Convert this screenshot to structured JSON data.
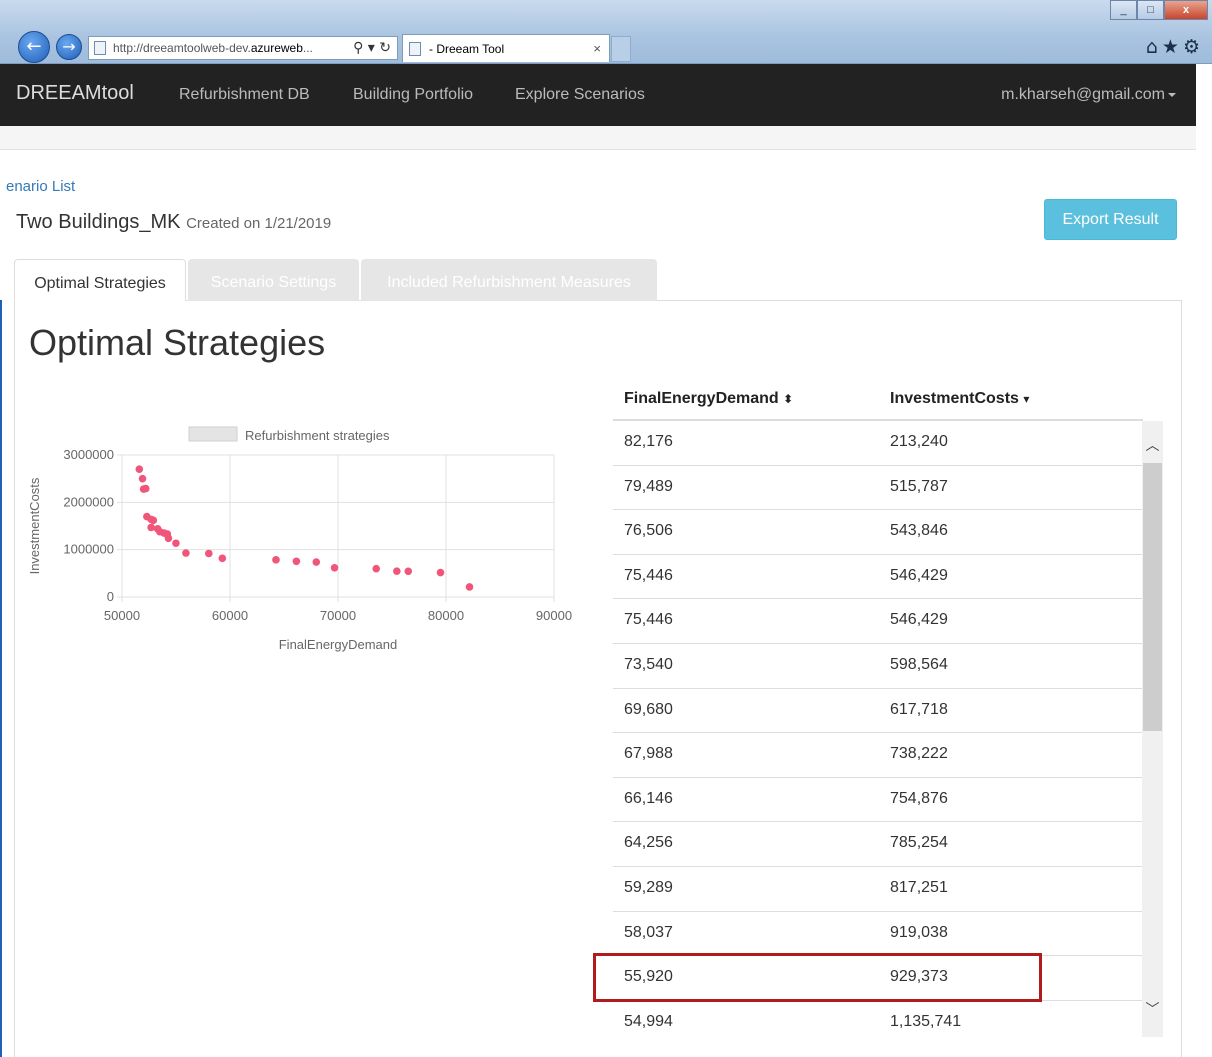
{
  "browser": {
    "url_prefix": "http://dreeamtoolweb-dev.",
    "url_bold": "azureweb",
    "url_suffix": "...",
    "tab_title": "- Dreeam Tool",
    "tab_close": "×",
    "back_glyph": "←",
    "forward_glyph": "→",
    "addr_tools": "⚲ ▾ ↻",
    "window_buttons": {
      "minimize": "_",
      "maximize": "□",
      "close": "x"
    },
    "toolbar_icons": "⌂★⚙"
  },
  "navbar": {
    "brand": "DREEAMtool",
    "links": [
      "Refurbishment DB",
      "Building Portfolio",
      "Explore Scenarios"
    ],
    "user": "m.kharseh@gmail.com"
  },
  "page": {
    "breadcrumb": "enario List",
    "title": "Two Buildings_MK",
    "created": "Created on 1/21/2019",
    "export_button": "Export Result",
    "tabs": [
      "Optimal Strategies",
      "Scenario Settings",
      "Included Refurbishment Measures"
    ],
    "heading": "Optimal Strategies"
  },
  "chart_data": {
    "type": "scatter",
    "legend": "Refurbishment strategies",
    "legend_position": "top",
    "xlabel": "FinalEnergyDemand",
    "ylabel": "InvestmentCosts",
    "xlim": [
      50000,
      90000
    ],
    "ylim": [
      0,
      3000000
    ],
    "xticks": [
      "50000",
      "60000",
      "70000",
      "80000",
      "90000"
    ],
    "yticks": [
      "0",
      "1000000",
      "2000000",
      "3000000"
    ],
    "grid": true,
    "point_color": "#f0567a",
    "points": [
      [
        51600,
        2700000
      ],
      [
        51900,
        2500000
      ],
      [
        52000,
        2280000
      ],
      [
        52200,
        2290000
      ],
      [
        52300,
        1700000
      ],
      [
        52700,
        1640000
      ],
      [
        52900,
        1620000
      ],
      [
        52700,
        1470000
      ],
      [
        53300,
        1440000
      ],
      [
        53500,
        1380000
      ],
      [
        53900,
        1350000
      ],
      [
        54200,
        1330000
      ],
      [
        54300,
        1240000
      ],
      [
        54994,
        1135741
      ],
      [
        55920,
        929373
      ],
      [
        58037,
        919038
      ],
      [
        59289,
        817251
      ],
      [
        64256,
        785254
      ],
      [
        66146,
        754876
      ],
      [
        67988,
        738222
      ],
      [
        69680,
        617718
      ],
      [
        73540,
        598564
      ],
      [
        75446,
        546429
      ],
      [
        76506,
        543846
      ],
      [
        79489,
        515787
      ],
      [
        82176,
        213240
      ]
    ]
  },
  "table": {
    "columns": [
      "FinalEnergyDemand",
      "InvestmentCosts"
    ],
    "col1_sort_icon": "⬍",
    "col2_sort_icon": "▾",
    "rows": [
      [
        "82,176",
        "213,240"
      ],
      [
        "79,489",
        "515,787"
      ],
      [
        "76,506",
        "543,846"
      ],
      [
        "75,446",
        "546,429"
      ],
      [
        "75,446",
        "546,429"
      ],
      [
        "73,540",
        "598,564"
      ],
      [
        "69,680",
        "617,718"
      ],
      [
        "67,988",
        "738,222"
      ],
      [
        "66,146",
        "754,876"
      ],
      [
        "64,256",
        "785,254"
      ],
      [
        "59,289",
        "817,251"
      ],
      [
        "58,037",
        "919,038"
      ],
      [
        "55,920",
        "929,373"
      ],
      [
        "54,994",
        "1,135,741"
      ]
    ],
    "scroll_up": "︿",
    "scroll_down": "﹀"
  }
}
